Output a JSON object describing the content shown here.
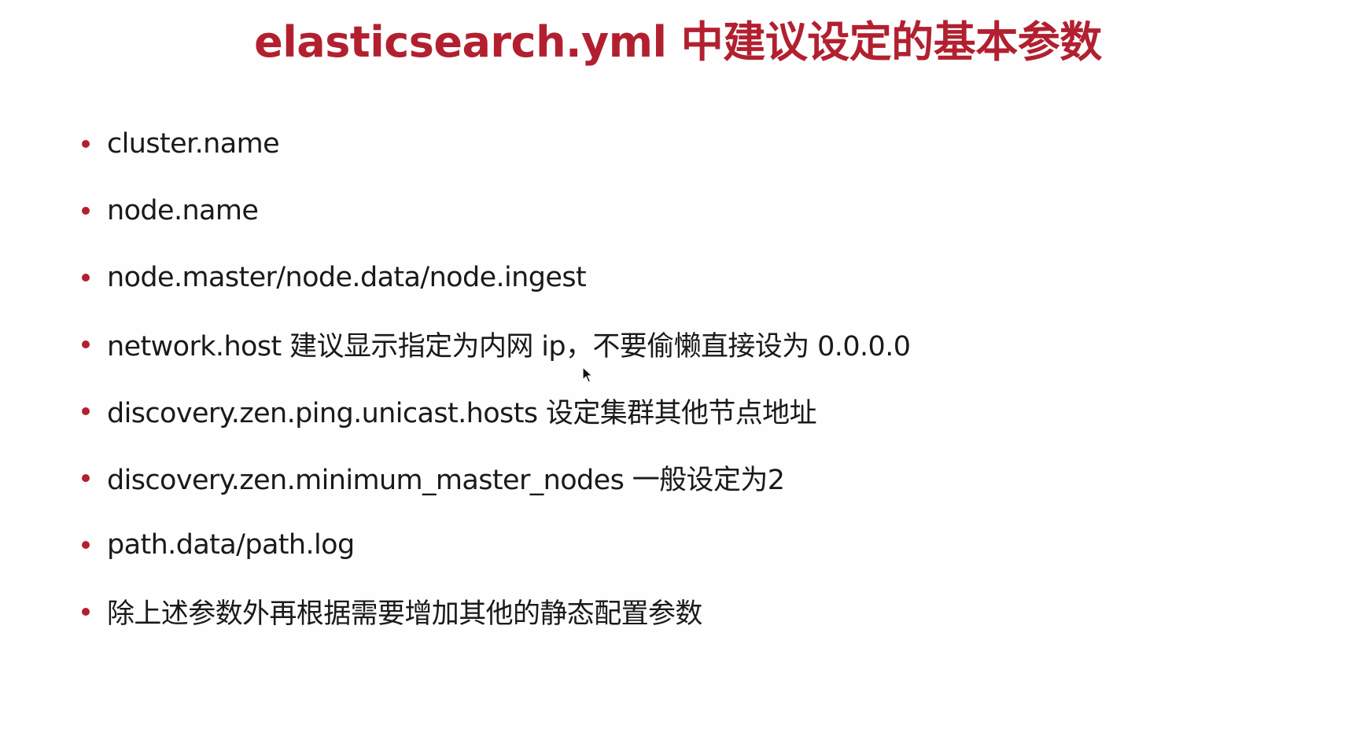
{
  "slide": {
    "title": "elasticsearch.yml 中建议设定的基本参数",
    "bullet_color": "#b2202f",
    "items": [
      {
        "text": "cluster.name"
      },
      {
        "text": "node.name"
      },
      {
        "text": "node.master/node.data/node.ingest"
      },
      {
        "text": "network.host 建议显示指定为内网 ip，不要偷懒直接设为 0.0.0.0"
      },
      {
        "text": "discovery.zen.ping.unicast.hosts 设定集群其他节点地址"
      },
      {
        "text": "discovery.zen.minimum_master_nodes 一般设定为2"
      },
      {
        "text": "path.data/path.log"
      },
      {
        "text": "除上述参数外再根据需要增加其他的静态配置参数"
      }
    ]
  },
  "cursor": {
    "icon": "arrow-cursor-icon"
  }
}
